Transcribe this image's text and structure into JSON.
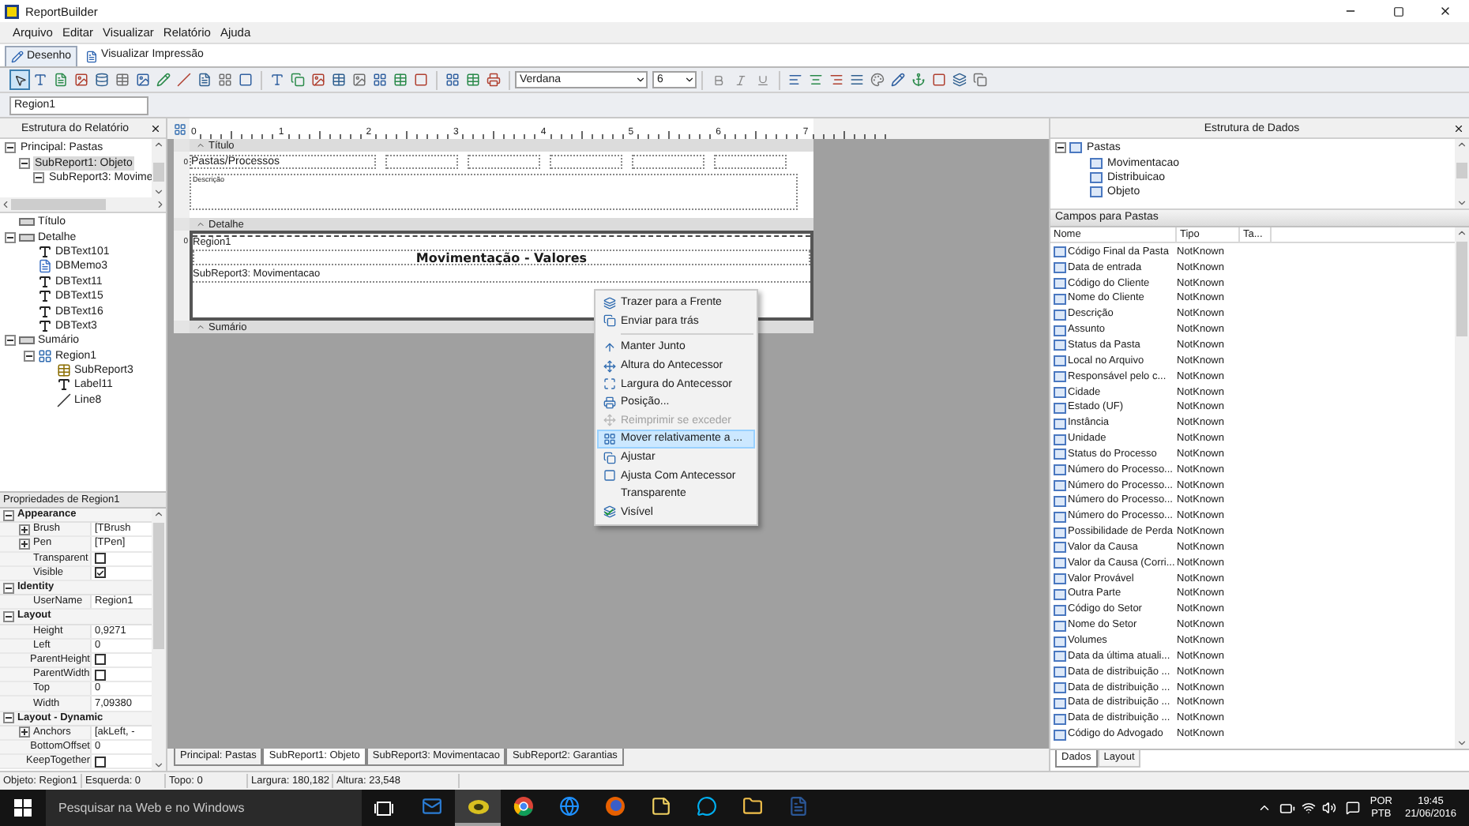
{
  "window": {
    "title": "ReportBuilder"
  },
  "menu": [
    {
      "label": "Arquivo"
    },
    {
      "label": "Editar"
    },
    {
      "label": "Visualizar"
    },
    {
      "label": "Relatório"
    },
    {
      "label": "Ajuda"
    }
  ],
  "mode_tabs": [
    {
      "label": "Desenho",
      "selected": true
    },
    {
      "label": "Visualizar Impressão",
      "selected": false
    }
  ],
  "toolbar": {
    "pointer_selected": true,
    "font": "Verdana",
    "size": "6"
  },
  "object_field": {
    "value": "Region1"
  },
  "report_tree": {
    "title": "Estrutura do Relatório",
    "subreports": [
      {
        "label": "Principal: Pastas",
        "expanded": true,
        "selected": false,
        "children": [
          {
            "label": "SubReport1: Objeto",
            "expanded": true,
            "selected": true,
            "children": [
              {
                "label": "SubReport3: Movime",
                "expanded": true,
                "selected": false
              }
            ]
          }
        ]
      }
    ],
    "components": [
      {
        "label": "Título",
        "kind": "band"
      },
      {
        "label": "Detalhe",
        "kind": "band",
        "expanded": true,
        "children": [
          {
            "label": "DBText101",
            "kind": "text"
          },
          {
            "label": "DBMemo3",
            "kind": "memo"
          },
          {
            "label": "DBText11",
            "kind": "text"
          },
          {
            "label": "DBText15",
            "kind": "text"
          },
          {
            "label": "DBText16",
            "kind": "text"
          },
          {
            "label": "DBText3",
            "kind": "text"
          }
        ]
      },
      {
        "label": "Sumário",
        "kind": "band",
        "expanded": true,
        "children": [
          {
            "label": "Region1",
            "kind": "region",
            "expanded": true,
            "children": [
              {
                "label": "SubReport3",
                "kind": "subreport"
              },
              {
                "label": "Label11",
                "kind": "text"
              },
              {
                "label": "Line8",
                "kind": "line"
              }
            ]
          }
        ]
      }
    ]
  },
  "properties": {
    "title": "Propriedades de Region1",
    "categories": [
      {
        "name": "Appearance",
        "expanded": true,
        "rows": [
          {
            "name": "Brush",
            "kind": "text",
            "expandable": true,
            "value": "[TBrush"
          },
          {
            "name": "Pen",
            "kind": "text",
            "expandable": true,
            "value": "[TPen]"
          },
          {
            "name": "Transparent",
            "kind": "checkbox",
            "checked": false
          },
          {
            "name": "Visible",
            "kind": "checkbox",
            "checked": true
          }
        ]
      },
      {
        "name": "Identity",
        "expanded": true,
        "rows": [
          {
            "name": "UserName",
            "kind": "text",
            "expandable": false,
            "value": "Region1"
          }
        ]
      },
      {
        "name": "Layout",
        "expanded": true,
        "rows": [
          {
            "name": "Height",
            "kind": "text",
            "expandable": false,
            "value": "0,9271"
          },
          {
            "name": "Left",
            "kind": "text",
            "expandable": false,
            "value": "0"
          },
          {
            "name": "ParentHeight",
            "kind": "checkbox",
            "checked": false
          },
          {
            "name": "ParentWidth",
            "kind": "checkbox",
            "checked": false
          },
          {
            "name": "Top",
            "kind": "text",
            "expandable": false,
            "value": "0"
          },
          {
            "name": "Width",
            "kind": "text",
            "expandable": false,
            "value": "7,09380"
          }
        ]
      },
      {
        "name": "Layout - Dynamic",
        "expanded": true,
        "rows": [
          {
            "name": "Anchors",
            "kind": "text",
            "expandable": true,
            "value": "[akLeft, -"
          },
          {
            "name": "BottomOffset",
            "kind": "text",
            "expandable": false,
            "value": "0"
          },
          {
            "name": "KeepTogether",
            "kind": "checkbox",
            "checked": false
          }
        ]
      }
    ]
  },
  "designer": {
    "ruler": [
      "0",
      "1",
      "2",
      "3",
      "4",
      "5",
      "6",
      "7"
    ],
    "title_band": {
      "header": "Título",
      "ruler_label": "0",
      "heading": "Pastas/Processos",
      "description": "Descrição"
    },
    "detail_band": {
      "header": "Detalhe",
      "ruler_label": "0",
      "region": "Region1",
      "heading": "Movimentação - Valores",
      "subreport": "SubReport3: Movimentacao"
    },
    "summary_band": {
      "header": "Sumário"
    }
  },
  "context_menu": [
    {
      "kind": "item",
      "label": "Trazer para a Frente",
      "icon": true,
      "disabled": false,
      "selected": false,
      "checked": false
    },
    {
      "kind": "item",
      "label": "Enviar para trás",
      "icon": true,
      "disabled": false,
      "selected": false,
      "checked": false
    },
    {
      "kind": "separator"
    },
    {
      "kind": "item",
      "label": "Manter Junto",
      "icon": true,
      "disabled": false,
      "selected": false,
      "checked": false
    },
    {
      "kind": "item",
      "label": "Altura do Antecessor",
      "icon": true,
      "disabled": false,
      "selected": false,
      "checked": false
    },
    {
      "kind": "item",
      "label": "Largura do Antecessor",
      "icon": true,
      "disabled": false,
      "selected": false,
      "checked": false
    },
    {
      "kind": "item",
      "label": "Posição...",
      "icon": true,
      "disabled": false,
      "selected": false,
      "checked": false
    },
    {
      "kind": "item",
      "label": "Reimprimir se exceder",
      "icon": true,
      "disabled": true,
      "selected": false,
      "checked": false
    },
    {
      "kind": "item",
      "label": "Mover relativamente a ...",
      "icon": true,
      "disabled": false,
      "selected": true,
      "checked": false
    },
    {
      "kind": "item",
      "label": "Ajustar",
      "icon": true,
      "disabled": false,
      "selected": false,
      "checked": false
    },
    {
      "kind": "item",
      "label": "Ajusta Com Antecessor",
      "icon": true,
      "disabled": false,
      "selected": false,
      "checked": false
    },
    {
      "kind": "item",
      "label": "Transparente",
      "icon": false,
      "disabled": false,
      "selected": false,
      "checked": false
    },
    {
      "kind": "item",
      "label": "Visível",
      "icon": true,
      "disabled": false,
      "selected": false,
      "checked": true
    }
  ],
  "report_tabs": [
    {
      "label": "Principal: Pastas",
      "selected": false
    },
    {
      "label": "SubReport1: Objeto",
      "selected": true
    },
    {
      "label": "SubReport3: Movimentacao",
      "selected": false
    },
    {
      "label": "SubReport2: Garantias",
      "selected": false
    }
  ],
  "data_tree": {
    "title": "Estrutura de Dados",
    "root": {
      "label": "Pastas",
      "expanded": true,
      "children": [
        {
          "label": "Movimentacao"
        },
        {
          "label": "Distribuicao"
        },
        {
          "label": "Objeto"
        }
      ]
    }
  },
  "fields": {
    "title": "Campos para Pastas",
    "columns": [
      "Nome",
      "Tipo",
      "Ta..."
    ],
    "rows": [
      {
        "name": "Código Final da Pasta",
        "type": "NotKnown"
      },
      {
        "name": "Data de entrada",
        "type": "NotKnown"
      },
      {
        "name": "Código do Cliente",
        "type": "NotKnown"
      },
      {
        "name": "Nome do Cliente",
        "type": "NotKnown"
      },
      {
        "name": "Descrição",
        "type": "NotKnown"
      },
      {
        "name": "Assunto",
        "type": "NotKnown"
      },
      {
        "name": "Status da Pasta",
        "type": "NotKnown"
      },
      {
        "name": "Local no Arquivo",
        "type": "NotKnown"
      },
      {
        "name": "Responsável pelo c...",
        "type": "NotKnown"
      },
      {
        "name": "Cidade",
        "type": "NotKnown"
      },
      {
        "name": "Estado (UF)",
        "type": "NotKnown"
      },
      {
        "name": "Instância",
        "type": "NotKnown"
      },
      {
        "name": "Unidade",
        "type": "NotKnown"
      },
      {
        "name": "Status do Processo",
        "type": "NotKnown"
      },
      {
        "name": "Número do Processo...",
        "type": "NotKnown"
      },
      {
        "name": "Número do Processo...",
        "type": "NotKnown"
      },
      {
        "name": "Número do Processo...",
        "type": "NotKnown"
      },
      {
        "name": "Número do Processo...",
        "type": "NotKnown"
      },
      {
        "name": "Possibilidade de Perda",
        "type": "NotKnown"
      },
      {
        "name": "Valor da Causa",
        "type": "NotKnown"
      },
      {
        "name": "Valor da Causa (Corri...",
        "type": "NotKnown"
      },
      {
        "name": "Valor Provável",
        "type": "NotKnown"
      },
      {
        "name": "Outra Parte",
        "type": "NotKnown"
      },
      {
        "name": "Código do Setor",
        "type": "NotKnown"
      },
      {
        "name": "Nome do Setor",
        "type": "NotKnown"
      },
      {
        "name": "Volumes",
        "type": "NotKnown"
      },
      {
        "name": "Data da última atuali...",
        "type": "NotKnown"
      },
      {
        "name": "Data de distribuição ...",
        "type": "NotKnown"
      },
      {
        "name": "Data de distribuição ...",
        "type": "NotKnown"
      },
      {
        "name": "Data de distribuição ...",
        "type": "NotKnown"
      },
      {
        "name": "Data de distribuição ...",
        "type": "NotKnown"
      },
      {
        "name": "Código do Advogado",
        "type": "NotKnown"
      }
    ]
  },
  "data_tabs": [
    {
      "label": "Dados",
      "selected": true
    },
    {
      "label": "Layout",
      "selected": false
    }
  ],
  "status_bar": [
    "Objeto: Region1",
    "Esquerda: 0",
    "Topo: 0",
    "Largura: 180,182",
    "Altura: 23,548"
  ],
  "taskbar": {
    "search_placeholder": "Pesquisar na Web e no Windows",
    "apps": [
      {
        "kind": "mail",
        "selected": false
      },
      {
        "kind": "app",
        "selected": true
      },
      {
        "kind": "browser",
        "selected": false
      },
      {
        "kind": "edge",
        "selected": false
      },
      {
        "kind": "fox",
        "selected": false
      },
      {
        "kind": "notes",
        "selected": false
      },
      {
        "kind": "chat",
        "selected": false
      },
      {
        "kind": "folder",
        "selected": false
      },
      {
        "kind": "document",
        "selected": false
      }
    ],
    "language": "POR",
    "layout": "PTB",
    "time": "19:45",
    "date": "21/06/2016"
  }
}
